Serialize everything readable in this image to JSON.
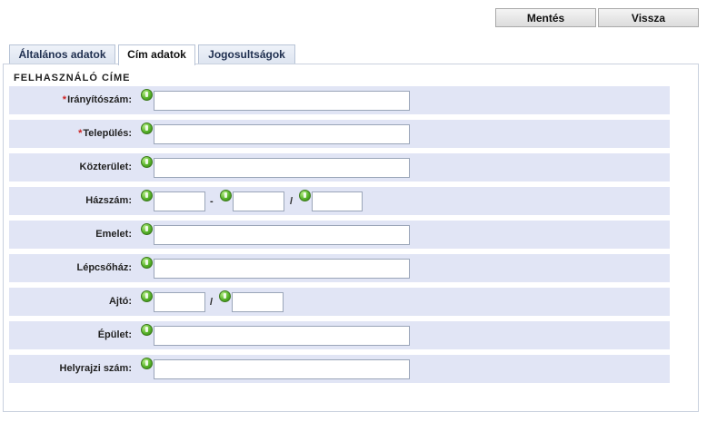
{
  "toolbar": {
    "save_label": "Mentés",
    "back_label": "Vissza"
  },
  "tabs": [
    {
      "label": "Általános adatok",
      "active": false
    },
    {
      "label": "Cím adatok",
      "active": true
    },
    {
      "label": "Jogosultságok",
      "active": false
    }
  ],
  "section": {
    "title": "FELHASZNÁLÓ CÍME"
  },
  "form": {
    "required_marker": "*",
    "fields": [
      {
        "label": "Irányítószám:",
        "required": true,
        "value": ""
      },
      {
        "label": "Település:",
        "required": true,
        "value": ""
      },
      {
        "label": "Közterület:",
        "required": false,
        "value": ""
      },
      {
        "label": "Házszám:",
        "required": false,
        "value": "",
        "separator_1": "-",
        "separator_2": "/"
      },
      {
        "label": "Emelet:",
        "required": false,
        "value": ""
      },
      {
        "label": "Lépcsőház:",
        "required": false,
        "value": ""
      },
      {
        "label": "Ajtó:",
        "required": false,
        "value": "",
        "separator_1": "/"
      },
      {
        "label": "Épület:",
        "required": false,
        "value": ""
      },
      {
        "label": "Helyrajzi szám:",
        "required": false,
        "value": ""
      }
    ]
  },
  "colors": {
    "row_background": "#e1e5f5",
    "required": "#cc2222",
    "help_icon": "#58b32a"
  },
  "icons": {
    "help": "green-help-icon"
  }
}
